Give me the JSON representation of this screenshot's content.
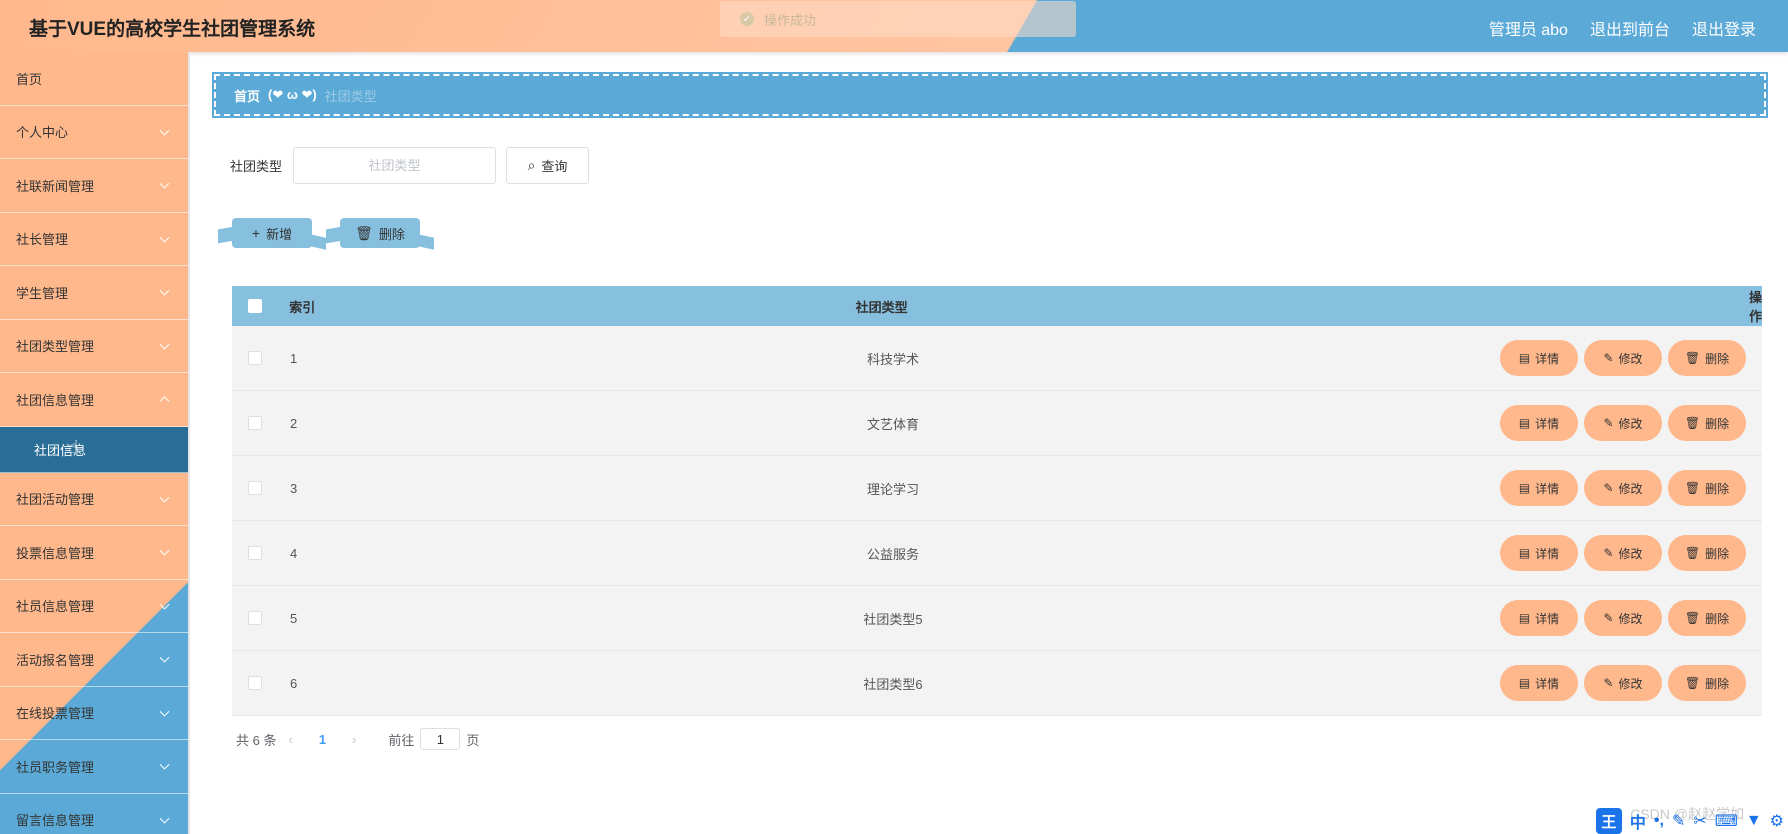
{
  "header": {
    "title": "基于VUE的高校学生社团管理系统",
    "user": "管理员 abo",
    "front_link": "退出到前台",
    "logout": "退出登录"
  },
  "toast": {
    "message": "操作成功"
  },
  "sidebar": {
    "items": [
      {
        "label": "首页",
        "chevron": "none"
      },
      {
        "label": "个人中心",
        "chevron": "down"
      },
      {
        "label": "社联新闻管理",
        "chevron": "down"
      },
      {
        "label": "社长管理",
        "chevron": "down"
      },
      {
        "label": "学生管理",
        "chevron": "down"
      },
      {
        "label": "社团类型管理",
        "chevron": "down"
      },
      {
        "label": "社团信息管理",
        "chevron": "up"
      },
      {
        "label": "社团信息",
        "sub": true
      },
      {
        "label": "社团活动管理",
        "chevron": "down"
      },
      {
        "label": "投票信息管理",
        "chevron": "down"
      },
      {
        "label": "社员信息管理",
        "chevron": "down"
      },
      {
        "label": "活动报名管理",
        "chevron": "down"
      },
      {
        "label": "在线投票管理",
        "chevron": "down"
      },
      {
        "label": "社员职务管理",
        "chevron": "down"
      },
      {
        "label": "留言信息管理",
        "chevron": "down"
      }
    ]
  },
  "breadcrumb": {
    "home": "首页",
    "separator": "(❤ ω ❤)",
    "current": "社团类型"
  },
  "search": {
    "label": "社团类型",
    "placeholder": "社团类型",
    "value": "",
    "button": "查询"
  },
  "actions": {
    "add": "新增",
    "delete": "删除"
  },
  "table": {
    "headers": {
      "index": "索引",
      "type": "社团类型",
      "ops": "操作"
    },
    "rows": [
      {
        "index": "1",
        "type": "科技学术"
      },
      {
        "index": "2",
        "type": "文艺体育"
      },
      {
        "index": "3",
        "type": "理论学习"
      },
      {
        "index": "4",
        "type": "公益服务"
      },
      {
        "index": "5",
        "type": "社团类型5"
      },
      {
        "index": "6",
        "type": "社团类型6"
      }
    ],
    "op_labels": {
      "detail": "详情",
      "edit": "修改",
      "delete": "删除"
    }
  },
  "pagination": {
    "total": "共 6 条",
    "current_page": "1",
    "goto": "前往",
    "page_suffix": "页",
    "goto_value": "1"
  },
  "watermark": "CSDN @赵赵学如",
  "ime": {
    "logo": "王",
    "mode": "中"
  },
  "colors": {
    "peach": "#ffb88c",
    "blue": "#5aa9d6",
    "light_blue": "#87bfdf",
    "active_nav": "#2a6e97"
  }
}
